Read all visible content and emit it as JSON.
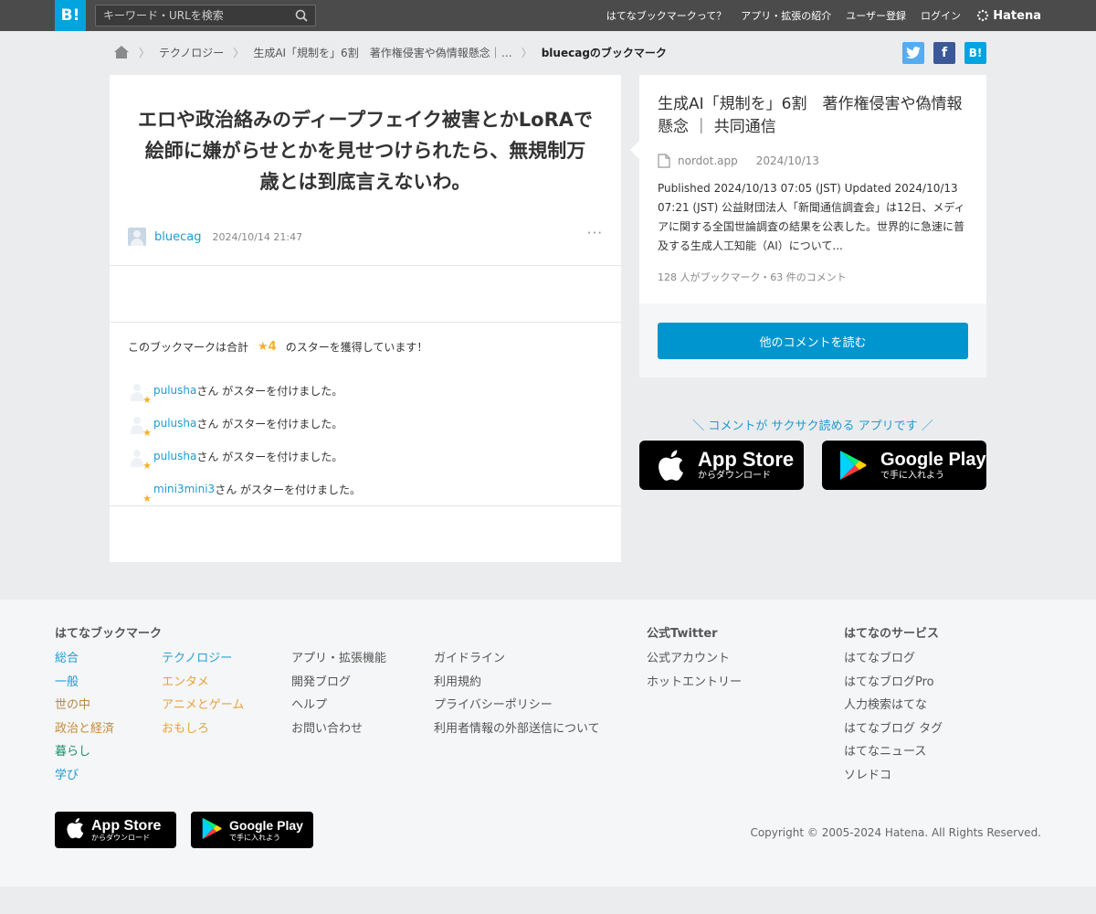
{
  "header": {
    "logo": "B!",
    "search_placeholder": "キーワード・URLを検索",
    "nav": [
      "はてなブックマークって？",
      "アプリ・拡張の紹介",
      "ユーザー登録",
      "ログイン"
    ],
    "brand": "Hatena"
  },
  "breadcrumb": {
    "items": [
      "テクノロジー",
      "生成AI「規制を」6割　著作権侵害や偽情報懸念｜…"
    ],
    "current": "bluecagのブックマーク"
  },
  "share": {
    "facebook": "f",
    "hatena": "B!"
  },
  "bookmark": {
    "comment": "エロや政治絡みのディープフェイク被害とかLoRAで絵師に嫌がらせとかを見せつけられたら、無規制万歳とは到底言えないわ。",
    "user": "bluecag",
    "date": "2024/10/14 21:47",
    "more": "···"
  },
  "stars": {
    "summary_prefix": "このブックマークは合計",
    "count": "★4",
    "summary_suffix": "のスターを獲得しています！",
    "given_text": "さん がスターを付けました。",
    "users": [
      "pulusha",
      "pulusha",
      "pulusha",
      "mini3mini3"
    ]
  },
  "entry": {
    "title": "生成AI「規制を」6割　著作権侵害や偽情報懸念 ｜ 共同通信",
    "domain": "nordot.app",
    "date": "2024/10/13",
    "description": "Published 2024/10/13 07:05 (JST) Updated 2024/10/13 07:21 (JST) 公益財団法人「新聞通信調査会」は12日、メディアに関する全国世論調査の結果を公表した。世界的に急速に普及する生成人工知能（AI）について...",
    "counts": "128 人がブックマーク・63 件のコメント",
    "read_button": "他のコメントを読む"
  },
  "app_promo": {
    "tagline": "＼ コメントが サクサク読める アプリです ／",
    "appstore_title": "App Store",
    "appstore_sub": "からダウンロード",
    "googleplay_title": "Google Play",
    "googleplay_sub": "で手に入れよう"
  },
  "footer": {
    "bookmark_heading": "はてなブックマーク",
    "categories_col1": [
      "総合",
      "一般",
      "世の中",
      "政治と経済",
      "暮らし",
      "学び"
    ],
    "categories_col2": [
      "テクノロジー",
      "エンタメ",
      "アニメとゲーム",
      "おもしろ"
    ],
    "links_col3": [
      "アプリ・拡張機能",
      "開発ブログ",
      "ヘルプ",
      "お問い合わせ"
    ],
    "links_col4": [
      "ガイドライン",
      "利用規約",
      "プライバシーポリシー",
      "利用者情報の外部送信について"
    ],
    "twitter_heading": "公式Twitter",
    "twitter_links": [
      "公式アカウント",
      "ホットエントリー"
    ],
    "services_heading": "はてなのサービス",
    "services_links": [
      "はてなブログ",
      "はてなブログPro",
      "人力検索はてな",
      "はてなブログ タグ",
      "はてなニュース",
      "ソレドコ"
    ],
    "appstore_title": "App Store",
    "appstore_sub": "からダウンロード",
    "googleplay_title": "Google Play",
    "googleplay_sub": "で手に入れよう",
    "copyright": "Copyright © 2005-2024 Hatena. All Rights Reserved."
  },
  "colors": {
    "header_bg": "#4b4b4b",
    "brand_blue": "#00a4de",
    "link_blue": "#1d9bd1",
    "button_blue": "#0095cf",
    "star_yellow": "#f4b128",
    "twitter": "#55acee",
    "facebook": "#3b5998"
  }
}
